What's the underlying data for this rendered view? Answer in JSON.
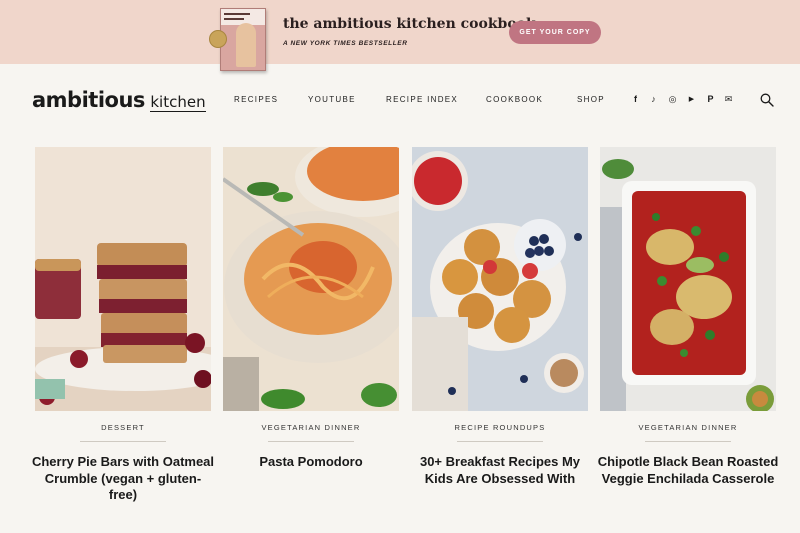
{
  "banner": {
    "title": "the ambitious kitchen cookbook",
    "subtitle": "A NEW YORK TIMES BESTSELLER",
    "cta_label": "GET YOUR COPY"
  },
  "header": {
    "logo_main": "ambitious",
    "logo_sub": "kitchen",
    "nav": [
      "RECIPES",
      "YOUTUBE",
      "RECIPE INDEX",
      "COOKBOOK",
      "SHOP"
    ],
    "social_icons": [
      "facebook-icon",
      "tiktok-icon",
      "instagram-icon",
      "youtube-icon",
      "pinterest-icon",
      "email-icon"
    ],
    "social_glyphs": [
      "f",
      "♪",
      "◎",
      "▶",
      "P",
      "✉"
    ]
  },
  "cards": [
    {
      "category": "DESSERT",
      "title": "Cherry Pie Bars with Oatmeal Crumble (vegan + gluten-free)"
    },
    {
      "category": "VEGETARIAN DINNER",
      "title": "Pasta Pomodoro"
    },
    {
      "category": "RECIPE ROUNDUPS",
      "title": "30+ Breakfast Recipes My Kids Are Obsessed With"
    },
    {
      "category": "VEGETARIAN DINNER",
      "title": "Chipotle Black Bean Roasted Veggie Enchilada Casserole"
    }
  ],
  "colors": {
    "banner_bg": "#f0d6cb",
    "cta_bg": "#c07582",
    "page_bg": "#f7f5f1"
  }
}
